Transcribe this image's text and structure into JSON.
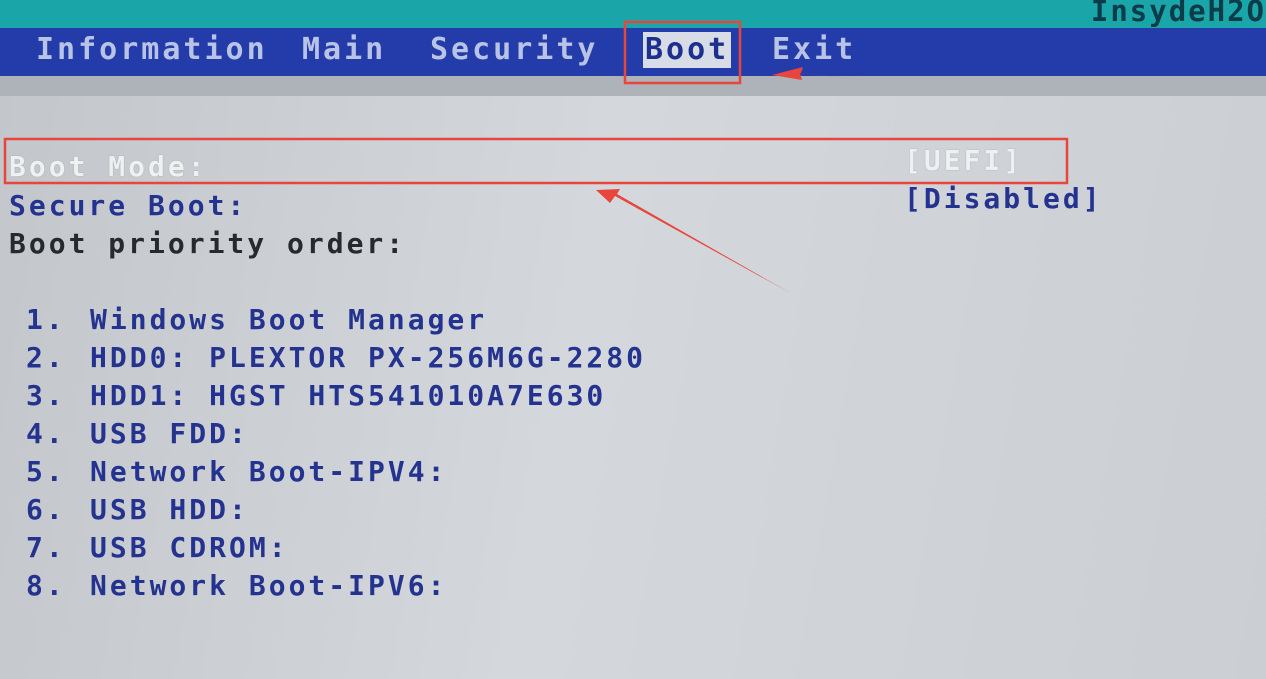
{
  "vendor": "InsydeH2O",
  "menu": {
    "tabs": [
      {
        "label": "Information"
      },
      {
        "label": "Main"
      },
      {
        "label": "Security"
      },
      {
        "label": "Boot"
      },
      {
        "label": "Exit"
      }
    ],
    "active_tab": "Boot"
  },
  "settings": {
    "boot_mode": {
      "label": "Boot Mode:",
      "value": "[UEFI]"
    },
    "secure_boot": {
      "label": "Secure Boot:",
      "value": "[Disabled]"
    },
    "priority_heading": "Boot priority order:"
  },
  "boot_order": [
    {
      "num": "1.",
      "device": "Windows Boot Manager"
    },
    {
      "num": "2.",
      "device": "HDD0: PLEXTOR PX-256M6G-2280"
    },
    {
      "num": "3.",
      "device": "HDD1: HGST HTS541010A7E630"
    },
    {
      "num": "4.",
      "device": "USB FDD:"
    },
    {
      "num": "5.",
      "device": "Network Boot-IPV4:"
    },
    {
      "num": "6.",
      "device": "USB HDD:"
    },
    {
      "num": "7.",
      "device": "USB CDROM:"
    },
    {
      "num": "8.",
      "device": "Network Boot-IPV6:"
    }
  ],
  "colors": {
    "menu_bar": "#233caa",
    "top_strip": "#1aa6a8",
    "panel": "#cfd3d6",
    "highlight_text": "#eef0f2",
    "item_text": "#24338f",
    "annotation": "#e8453c"
  }
}
